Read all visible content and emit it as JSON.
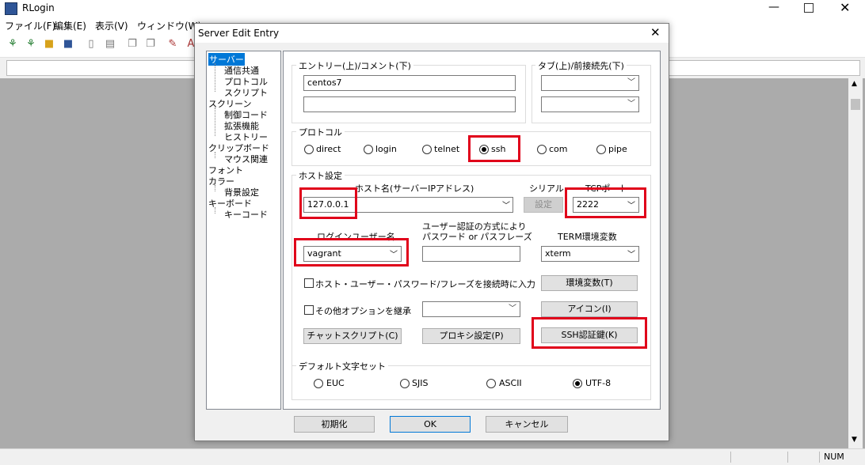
{
  "app": {
    "title": "RLogin",
    "menu": [
      "ファイル(F)",
      "編集(E)",
      "表示(V)",
      "ウィンドウ(W)"
    ],
    "status": "NUM"
  },
  "dialog": {
    "title": "Server Edit Entry",
    "tree": {
      "items": [
        "サーバー",
        "通信共通",
        "プロトコル",
        "スクリプト",
        "スクリーン",
        "制御コード",
        "拡張機能",
        "ヒストリー",
        "クリップボード",
        "マウス関連",
        "フォント",
        "カラー",
        "背景設定",
        "キーボード",
        "キーコード"
      ]
    },
    "entry": {
      "group_label": "エントリー(上)/コメント(下)",
      "entry_value": "centos7",
      "comment_value": ""
    },
    "tab": {
      "group_label": "タブ(上)/前接続先(下)"
    },
    "protocol": {
      "group_label": "プロトコル",
      "options": [
        "direct",
        "login",
        "telnet",
        "ssh",
        "com",
        "pipe"
      ],
      "selected": "ssh"
    },
    "host": {
      "group_label": "ホスト設定",
      "hostname_label": "ホスト名(サーバーIPアドレス)",
      "hostname_value": "127.0.0.1",
      "serial_label": "シリアル",
      "serial_button": "設定",
      "port_label": "TCPポート",
      "port_value": "2222",
      "login_user_label": "ログインユーザー名",
      "login_user_value": "vagrant",
      "auth_label_line1": "ユーザー認証の方式により",
      "auth_label_line2": "パスワード or パスフレーズ",
      "term_label": "TERM環境変数",
      "term_value": "xterm",
      "prompt_checkbox": "ホスト・ユーザー・パスワード/フレーズを接続時に入力",
      "inherit_checkbox": "その他オプションを継承",
      "env_button": "環境変数(T)",
      "icon_button": "アイコン(I)",
      "chat_button": "チャットスクリプト(C)",
      "proxy_button": "プロキシ設定(P)",
      "sshkey_button": "SSH認証鍵(K)"
    },
    "charset": {
      "group_label": "デフォルト文字セット",
      "options": [
        "EUC",
        "SJIS",
        "ASCII",
        "UTF-8"
      ],
      "selected": "UTF-8"
    },
    "buttons": {
      "reset": "初期化",
      "ok": "OK",
      "cancel": "キャンセル"
    },
    "highlight_color": "#e0001a"
  }
}
